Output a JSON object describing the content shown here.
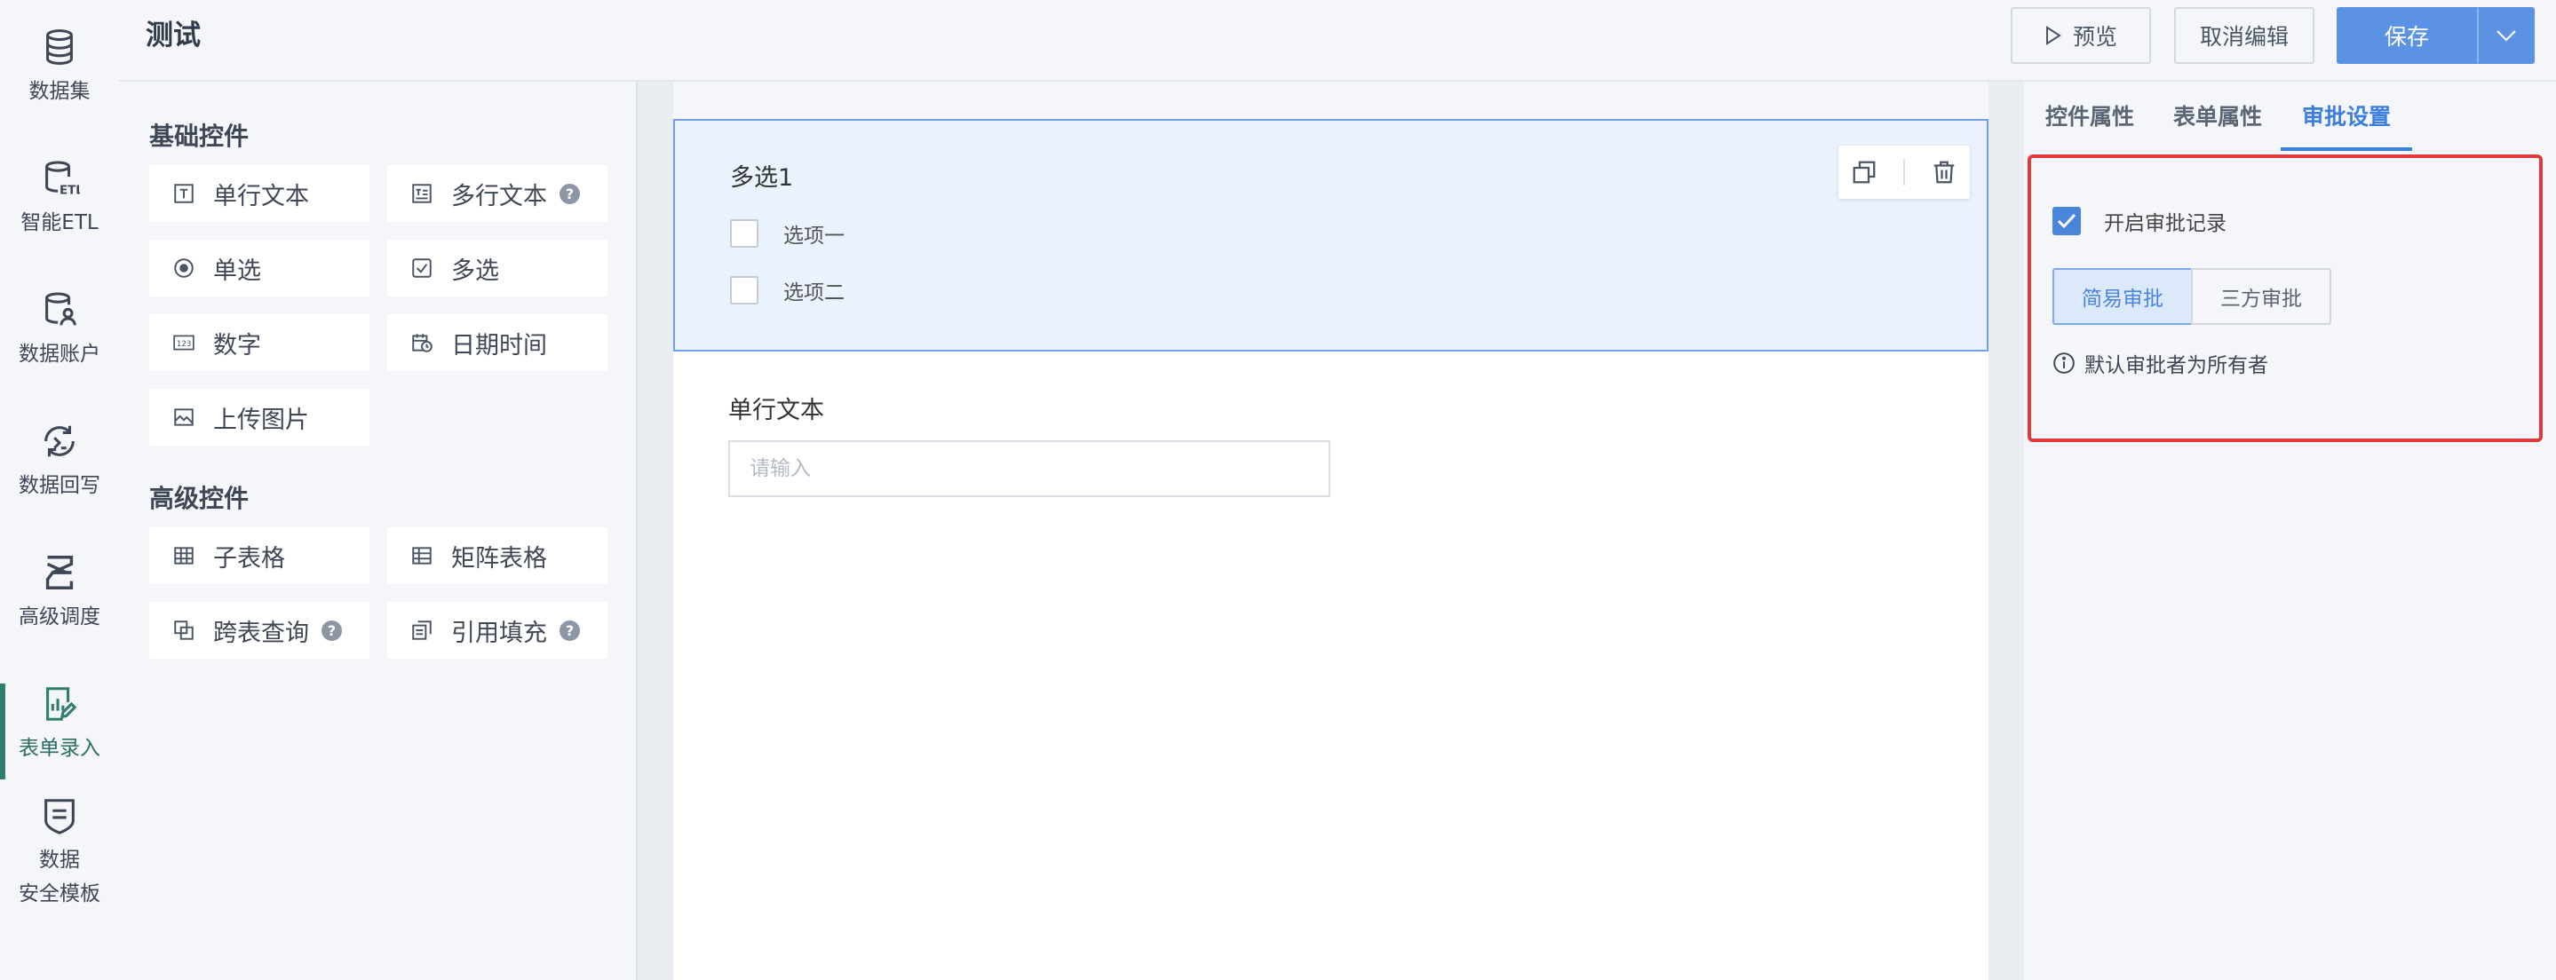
{
  "nav": {
    "items": [
      {
        "label": "数据集",
        "icon": "database-icon"
      },
      {
        "label": "智能ETL",
        "icon": "etl-icon"
      },
      {
        "label": "数据账户",
        "icon": "data-account-icon"
      },
      {
        "label": "数据回写",
        "icon": "writeback-icon"
      },
      {
        "label": "高级调度",
        "icon": "schedule-icon"
      },
      {
        "label": "表单录入",
        "icon": "form-entry-icon",
        "active": true
      },
      {
        "label_line1": "数据",
        "label_line2": "安全模板",
        "icon": "security-template-icon"
      }
    ]
  },
  "header": {
    "title": "测试",
    "preview_label": "预览",
    "cancel_label": "取消编辑",
    "save_label": "保存"
  },
  "palette": {
    "basic_title": "基础控件",
    "advanced_title": "高级控件",
    "basic": [
      {
        "label": "单行文本",
        "icon": "single-line-text-icon"
      },
      {
        "label": "多行文本",
        "icon": "multi-line-text-icon",
        "help": "?"
      },
      {
        "label": "单选",
        "icon": "radio-icon"
      },
      {
        "label": "多选",
        "icon": "checkbox-icon"
      },
      {
        "label": "数字",
        "icon": "number-icon"
      },
      {
        "label": "日期时间",
        "icon": "datetime-icon"
      },
      {
        "label": "上传图片",
        "icon": "image-upload-icon"
      }
    ],
    "advanced": [
      {
        "label": "子表格",
        "icon": "sub-table-icon"
      },
      {
        "label": "矩阵表格",
        "icon": "matrix-table-icon"
      },
      {
        "label": "跨表查询",
        "icon": "cross-query-icon",
        "help": "?"
      },
      {
        "label": "引用填充",
        "icon": "reference-fill-icon",
        "help": "?"
      }
    ]
  },
  "canvas": {
    "multi_select": {
      "label": "多选1",
      "options": [
        "选项一",
        "选项二"
      ]
    },
    "single_text": {
      "label": "单行文本",
      "placeholder": "请输入"
    }
  },
  "right_panel": {
    "tabs": [
      "控件属性",
      "表单属性",
      "审批设置"
    ],
    "active_tab": "审批设置",
    "enable_record_label": "开启审批记录",
    "enable_record_checked": true,
    "mode_simple": "简易审批",
    "mode_three": "三方审批",
    "selected_mode": "简易审批",
    "info_text": "默认审批者为所有者"
  },
  "colors": {
    "accent": "#5b92e4",
    "active_nav": "#2e7d6e",
    "highlight_box": "#e23a3a"
  }
}
